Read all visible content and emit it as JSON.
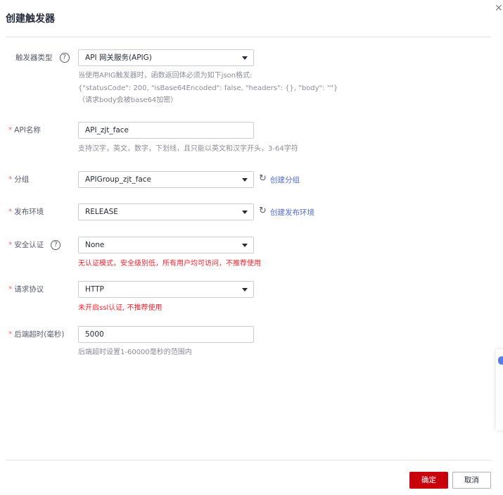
{
  "dialog": {
    "title": "创建触发器",
    "close_icon": "close-icon"
  },
  "form": {
    "trigger_type": {
      "label": "触发器类型",
      "value": "API 网关服务(APIG)",
      "hints": [
        "当使用APIG触发器时，函数返回体必须为如下json格式:",
        "{\"statusCode\": 200, \"isBase64Encoded\": false, \"headers\": {}, \"body\": \"\"}",
        "（请求body会被base64加密）"
      ]
    },
    "api_name": {
      "label": "API名称",
      "value": "API_zjt_face",
      "hint": "支持汉字，英文，数字，下划线，且只能以英文和汉字开头，3-64字符"
    },
    "group": {
      "label": "分组",
      "value": "APIGroup_zjt_face",
      "link": "创建分组"
    },
    "env": {
      "label": "发布环境",
      "value": "RELEASE",
      "link": "创建发布环境"
    },
    "auth": {
      "label": "安全认证",
      "value": "None",
      "warning": "无认证模式，安全级别低，所有用户均可访问，不推荐使用"
    },
    "protocol": {
      "label": "请求协议",
      "value": "HTTP",
      "warning": "未开启ssl认证, 不推荐使用"
    },
    "timeout": {
      "label": "后端超时(毫秒)",
      "value": "5000",
      "hint": "后端超时设置1-60000毫秒的范围内"
    }
  },
  "footer": {
    "confirm": "确定",
    "cancel": "取消"
  },
  "colors": {
    "primary": "#c7000b",
    "link": "#526ecc",
    "warning": "#f5222d",
    "required": "#f66f6a"
  }
}
